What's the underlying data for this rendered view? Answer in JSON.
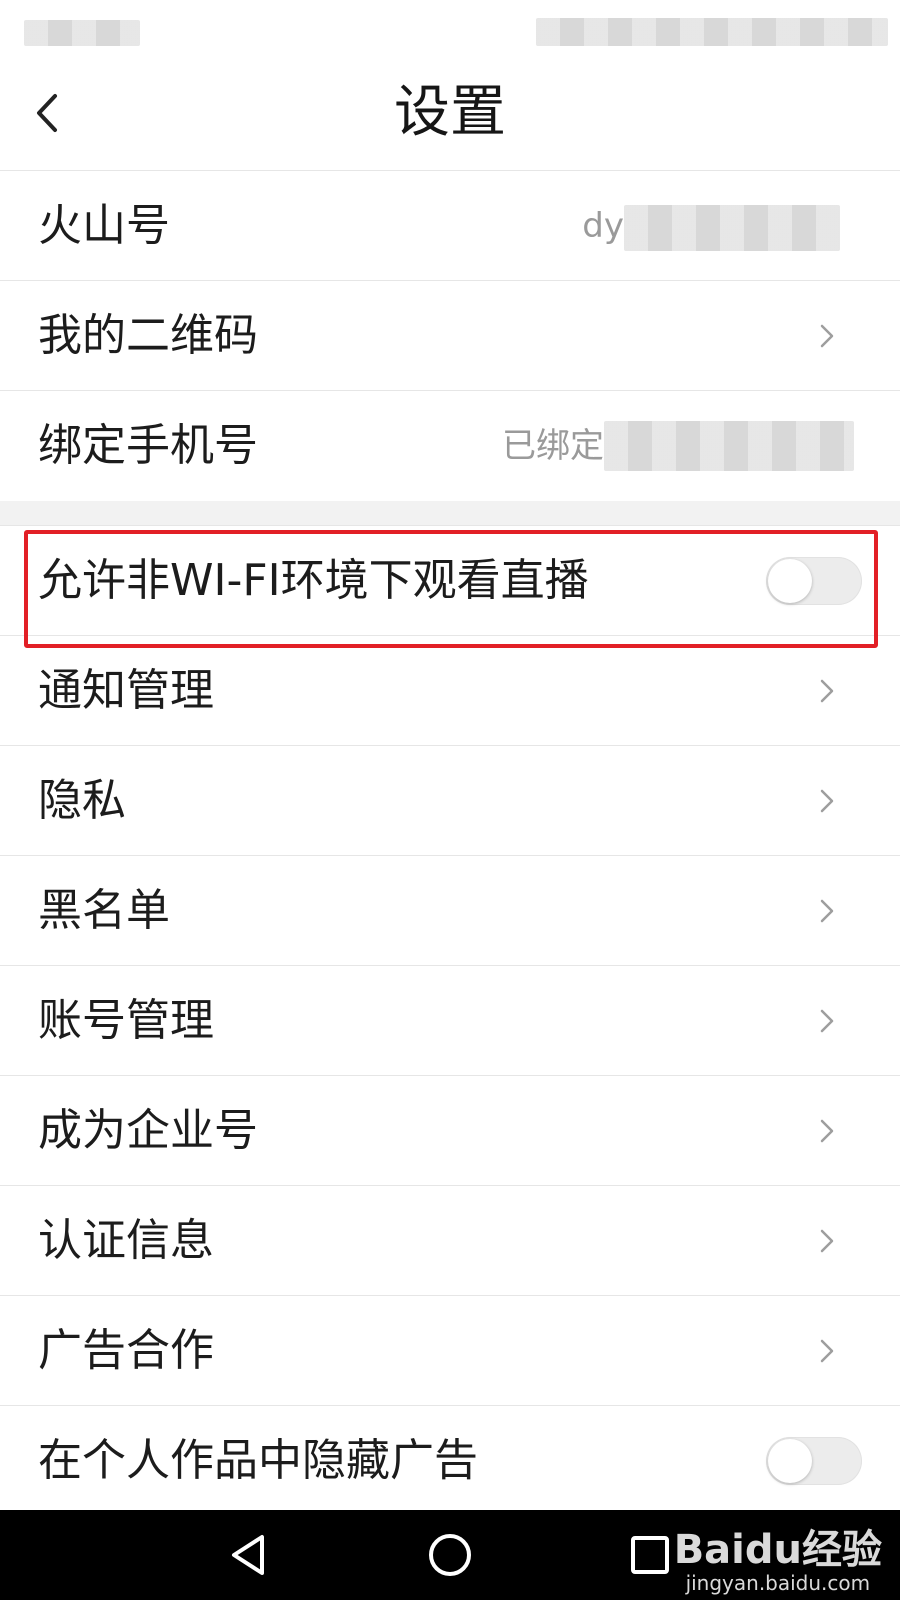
{
  "header": {
    "title": "设置"
  },
  "account_rows": [
    {
      "label": "火山号",
      "value": "dy"
    },
    {
      "label": "我的二维码"
    },
    {
      "label": "绑定手机号",
      "value": "已绑定"
    }
  ],
  "wifi_row": {
    "label": "允许非WI-FI环境下观看直播",
    "toggle_on": false
  },
  "menu_rows": [
    {
      "label": "通知管理"
    },
    {
      "label": "隐私"
    },
    {
      "label": "黑名单"
    },
    {
      "label": "账号管理"
    },
    {
      "label": "成为企业号"
    },
    {
      "label": "认证信息"
    },
    {
      "label": "广告合作"
    }
  ],
  "hide_ads_row": {
    "label": "在个人作品中隐藏广告",
    "toggle_on": false
  },
  "highlight_color": "#e21f26",
  "watermark": {
    "brand": "Baidu经验",
    "site": "jingyan.baidu.com"
  },
  "icons": {
    "back": "chevron-left-icon",
    "row_arrow": "chevron-right-icon",
    "nav": [
      "triangle-back-icon",
      "circle-home-icon",
      "square-recents-icon"
    ]
  }
}
